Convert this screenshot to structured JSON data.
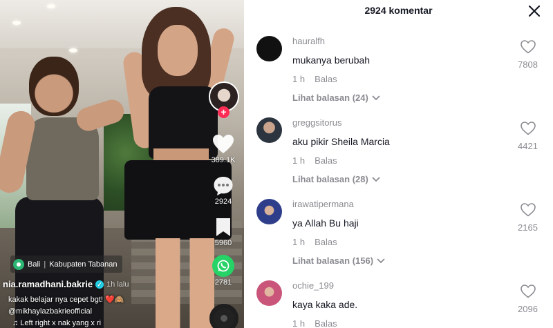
{
  "video": {
    "location": {
      "city": "Bali",
      "separator": "|",
      "region": "Kabupaten Tabanan"
    },
    "author": {
      "name": "nia.ramadhani.bakrie",
      "posted_ago": "1h lalu"
    },
    "caption_lines": [
      "kakak belajar nya cepet bgt! ❤️🙈",
      "@mikhaylazbakrieofficial"
    ],
    "music": "♫ Left right x nak yang x ri",
    "actions": {
      "likes": "389.1K",
      "comments": "2924",
      "bookmarks": "5960",
      "shares": "2781"
    },
    "icons": {
      "like": "heart-icon",
      "comment": "comment-bubble-icon",
      "bookmark": "bookmark-icon",
      "share": "whatsapp-icon",
      "follow": "plus-icon",
      "location": "location-pin-icon",
      "verified": "verified-badge-icon"
    }
  },
  "comments_panel": {
    "title": "2924 komentar",
    "close_icon": "close-icon",
    "comments": [
      {
        "user": "hauralfh",
        "text": "mukanya berubah",
        "time": "1 h",
        "reply": "Balas",
        "view_replies": "Lihat balasan (24)",
        "likes": "7808",
        "avatar_color": "#111111"
      },
      {
        "user": "greggsitorus",
        "text": "aku pikir Sheila Marcia",
        "time": "1 h",
        "reply": "Balas",
        "view_replies": "Lihat balasan (28)",
        "likes": "4421",
        "avatar_color": "#3a4a5c"
      },
      {
        "user": "irawatipermana",
        "text": "ya Allah Bu haji",
        "time": "1 h",
        "reply": "Balas",
        "view_replies": "Lihat balasan (156)",
        "likes": "2165",
        "avatar_color": "#2f3e8a"
      },
      {
        "user": "ochie_199",
        "text": "kaya kaka ade.",
        "time": "1 h",
        "reply": "Balas",
        "view_replies": "",
        "likes": "2096",
        "avatar_color": "#c9557a"
      }
    ]
  },
  "colors": {
    "accent": "#fe2c55",
    "whatsapp": "#25d366",
    "verified": "#20d5ec",
    "muted_text": "#8a8b91",
    "primary_text": "#161823"
  }
}
